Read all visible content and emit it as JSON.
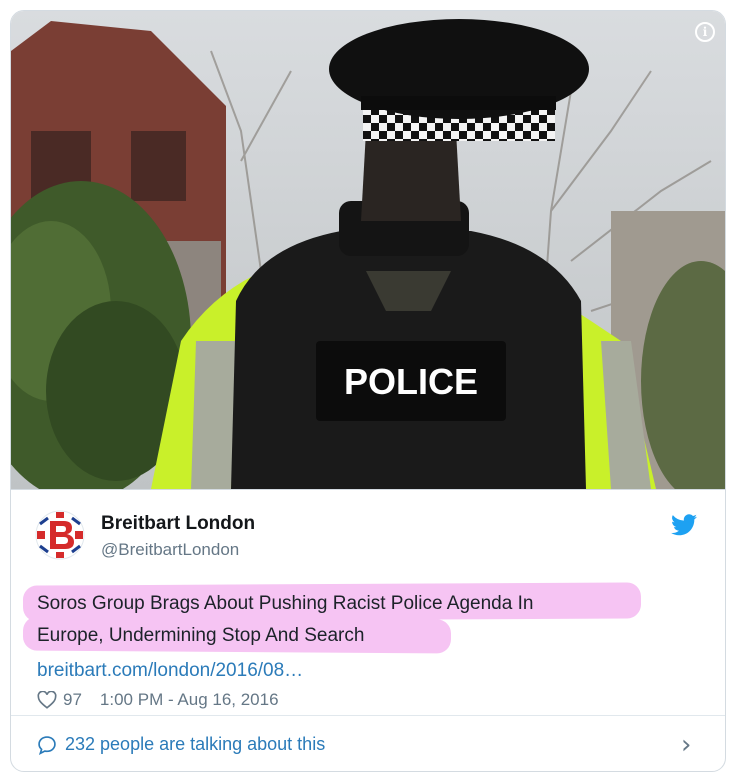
{
  "image": {
    "caption": "POLICE"
  },
  "tweet": {
    "author_name": "Breitbart London",
    "author_handle": "@BreitbartLondon",
    "headline_line1": "Soros Group Brags About Pushing Racist Police Agenda In",
    "headline_line2": "Europe, Undermining Stop And Search",
    "link": "breitbart.com/london/2016/08…",
    "likes": "97",
    "timestamp": "1:00 PM - Aug 16, 2016",
    "icons": {
      "info": "info-icon",
      "bird": "twitter-bird-icon",
      "heart": "heart-icon"
    }
  },
  "footer": {
    "talking": "232 people are talking about this",
    "icons": {
      "bubble": "speech-bubble-icon",
      "chevron": "chevron-right-icon"
    }
  },
  "colors": {
    "link": "#2b7bb9",
    "highlight": "#f6c4f3",
    "muted": "#657786",
    "vest": "#c9f02a"
  }
}
